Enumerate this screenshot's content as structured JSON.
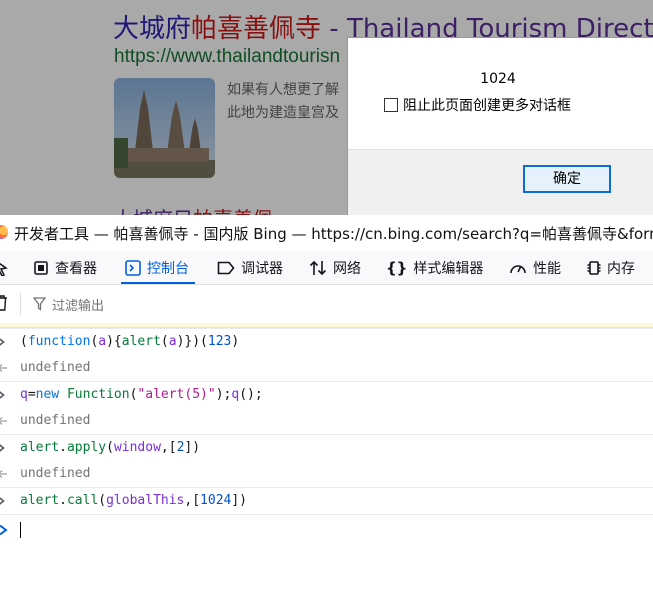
{
  "search_result": {
    "title_zh": "大城府",
    "title_hl": "帕喜善佩寺",
    "title_en": " - Thailand Tourism Director",
    "url": "https://www.thailandtourisn",
    "snippet_line1": "如果有人想更了解",
    "snippet_line2": "此地为建造皇宫及",
    "next_title_prefix": "大城",
    "next_title_mid": "府目",
    "next_title_hl": "帕喜善佩"
  },
  "dialog": {
    "message": "1024",
    "suppress_label": "阻止此页面创建更多对话框",
    "ok_label": "确定"
  },
  "devtools": {
    "window_title": "开发者工具 — 帕喜善佩寺 - 国内版 Bing — https://cn.bing.com/search?q=帕喜善佩寺&form",
    "tabs": [
      {
        "label": "查看器",
        "icon": "inspector-icon"
      },
      {
        "label": "控制台",
        "icon": "console-icon",
        "active": true
      },
      {
        "label": "调试器",
        "icon": "debugger-icon"
      },
      {
        "label": "网络",
        "icon": "network-icon"
      },
      {
        "label": "样式编辑器",
        "icon": "style-editor-icon"
      },
      {
        "label": "性能",
        "icon": "performance-icon"
      },
      {
        "label": "内存",
        "icon": "memory-icon"
      }
    ],
    "filter_placeholder": "过滤输出",
    "console": [
      {
        "type": "input",
        "text": "(function(a){alert(a)})(123)"
      },
      {
        "type": "output",
        "text": "undefined"
      },
      {
        "type": "input",
        "text": "q=new Function(\"alert(5)\");q();"
      },
      {
        "type": "output",
        "text": "undefined"
      },
      {
        "type": "input",
        "text": "alert.apply(window,[2])"
      },
      {
        "type": "output",
        "text": "undefined"
      },
      {
        "type": "input",
        "text": "alert.call(globalThis,[1024])"
      }
    ],
    "accent_color": "#0060df"
  }
}
